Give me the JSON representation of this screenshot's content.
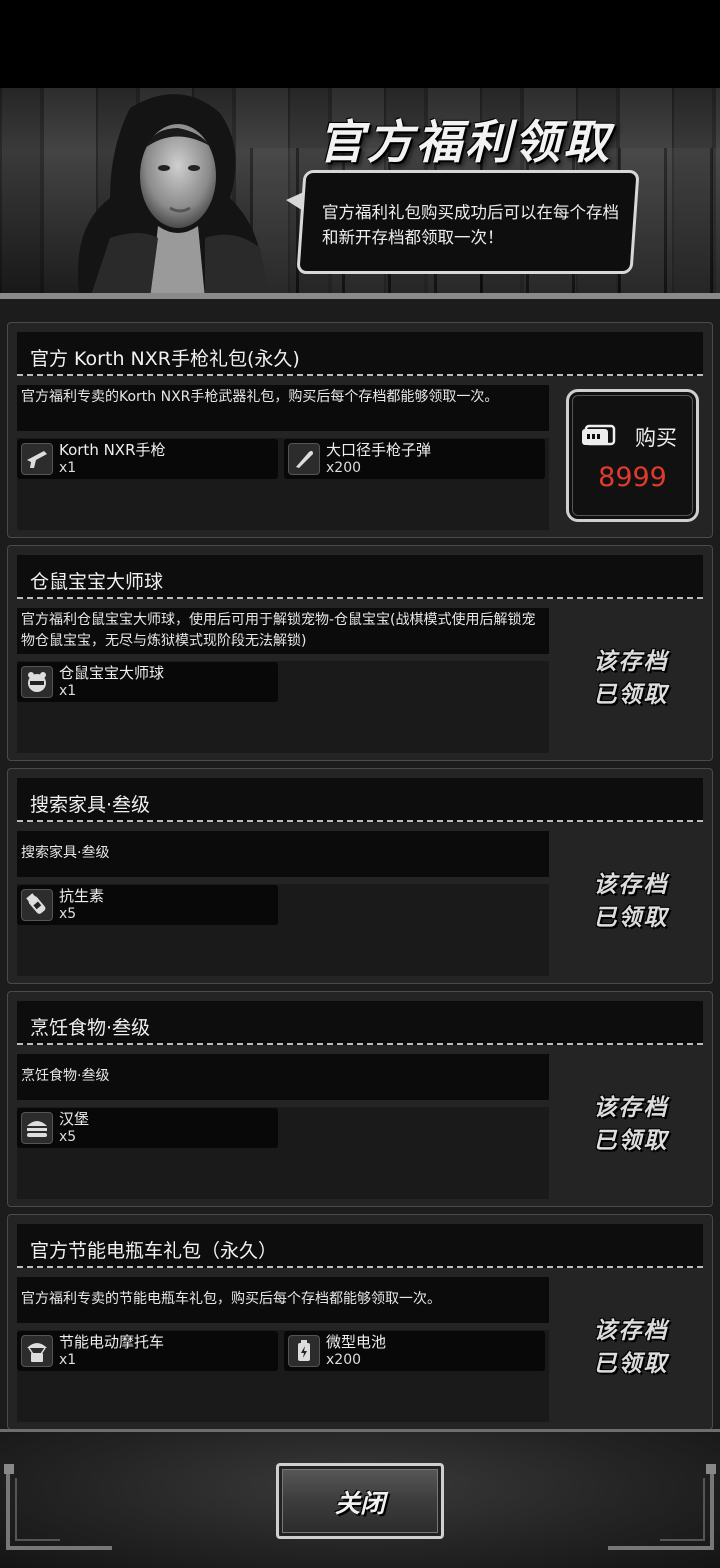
{
  "header": {
    "title": "官方福利领取",
    "bubble_text": "官方福利礼包购买成功后可以在每个存档和新开存档都领取一次！"
  },
  "cards": [
    {
      "title": "官方 Korth NXR手枪礼包(永久)",
      "description": "官方福利专卖的Korth NXR手枪武器礼包，购买后每个存档都能够领取一次。",
      "items": [
        {
          "name": "Korth NXR手枪",
          "qty": "x1",
          "icon": "pistol-icon"
        },
        {
          "name": "大口径手枪子弹",
          "qty": "x200",
          "icon": "bullet-icon"
        }
      ],
      "action": "buy",
      "buy_label": "购买",
      "price": "8999"
    },
    {
      "title": "仓鼠宝宝大师球",
      "description": "官方福利仓鼠宝宝大师球，使用后可用于解锁宠物-仓鼠宝宝(战棋模式使用后解锁宠物仓鼠宝宝，无尽与炼狱模式现阶段无法解锁)",
      "items": [
        {
          "name": "仓鼠宝宝大师球",
          "qty": "x1",
          "icon": "hamster-ball-icon"
        }
      ],
      "action": "claimed",
      "claimed_line1": "该存档",
      "claimed_line2": "已领取"
    },
    {
      "title": "搜索家具·叁级",
      "description": "搜索家具·叁级",
      "items": [
        {
          "name": "抗生素",
          "qty": "x5",
          "icon": "antibiotic-icon"
        }
      ],
      "action": "claimed",
      "claimed_line1": "该存档",
      "claimed_line2": "已领取"
    },
    {
      "title": "烹饪食物·叁级",
      "description": "烹饪食物·叁级",
      "items": [
        {
          "name": "汉堡",
          "qty": "x5",
          "icon": "burger-icon"
        }
      ],
      "action": "claimed",
      "claimed_line1": "该存档",
      "claimed_line2": "已领取"
    },
    {
      "title": "官方节能电瓶车礼包（永久）",
      "description": "官方福利专卖的节能电瓶车礼包，购买后每个存档都能够领取一次。",
      "items": [
        {
          "name": "节能电动摩托车",
          "qty": "x1",
          "icon": "airdrop-scooter-icon"
        },
        {
          "name": "微型电池",
          "qty": "x200",
          "icon": "battery-icon"
        }
      ],
      "action": "claimed",
      "claimed_line1": "该存档",
      "claimed_line2": "已领取"
    }
  ],
  "footer": {
    "close_label": "关闭"
  },
  "colors": {
    "price": "#e03a2e",
    "card_bg": "#242424",
    "title_bar_bg": "#0d0d0d"
  }
}
